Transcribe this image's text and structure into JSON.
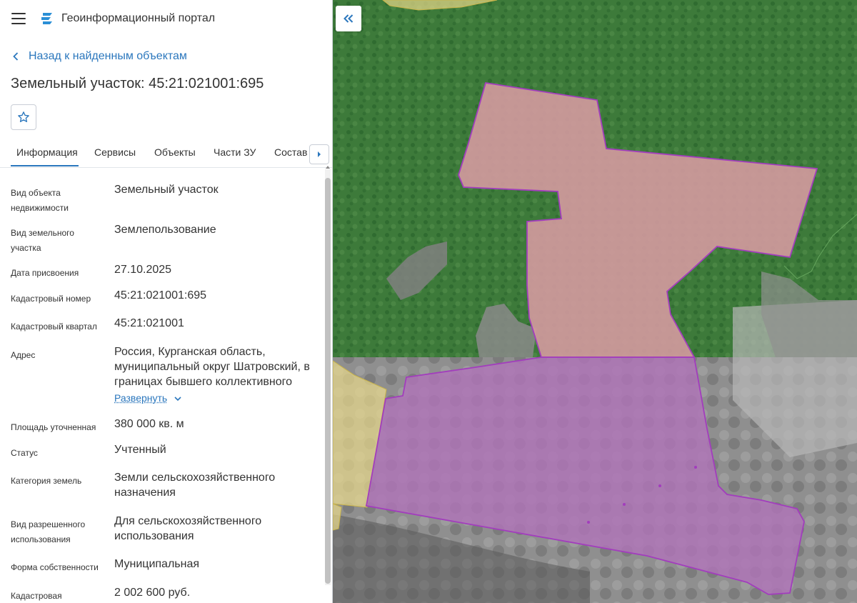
{
  "header": {
    "title": "Геоинформационный портал",
    "menu_icon": "hamburger-icon",
    "logo_icon": "portal-logo-icon"
  },
  "nav": {
    "back_label": "Назад к найденным объектам"
  },
  "object": {
    "title": "Земельный участок: 45:21:021001:695"
  },
  "tabs": [
    {
      "label": "Информация",
      "active": true
    },
    {
      "label": "Сервисы"
    },
    {
      "label": "Объекты"
    },
    {
      "label": "Части ЗУ"
    },
    {
      "label": "Состав"
    }
  ],
  "properties": [
    {
      "label": "Вид объекта недвижимости",
      "value": "Земельный участок"
    },
    {
      "label": "Вид земельного участка",
      "value": "Землепользование"
    },
    {
      "label": "Дата присвоения",
      "value": "27.10.2025"
    },
    {
      "label": "Кадастровый номер",
      "value": "45:21:021001:695"
    },
    {
      "label": "Кадастровый квартал",
      "value": "45:21:021001"
    },
    {
      "label": "Адрес",
      "value": "Россия, Курганская область, муниципальный округ Шатровский, в границах бывшего коллективного",
      "expand_label": "Развернуть"
    },
    {
      "label": "Площадь уточненная",
      "value": "380 000 кв. м"
    },
    {
      "label": "Статус",
      "value": "Учтенный"
    },
    {
      "label": "Категория земель",
      "value": "Земли сельскохозяйственного назначения"
    },
    {
      "label": "Вид разрешенного использования",
      "value": "Для сельскохозяйственного использования"
    },
    {
      "label": "Форма собственности",
      "value": "Муниципальная"
    },
    {
      "label": "Кадастровая",
      "value": "2 002 600 руб."
    }
  ],
  "colors": {
    "accent": "#2b77bd",
    "forest": "#3f7a3c",
    "parcel_fill": "#d49aa0",
    "parcel_border": "#a23dbd",
    "neighbor_fill": "#e8d98a"
  }
}
